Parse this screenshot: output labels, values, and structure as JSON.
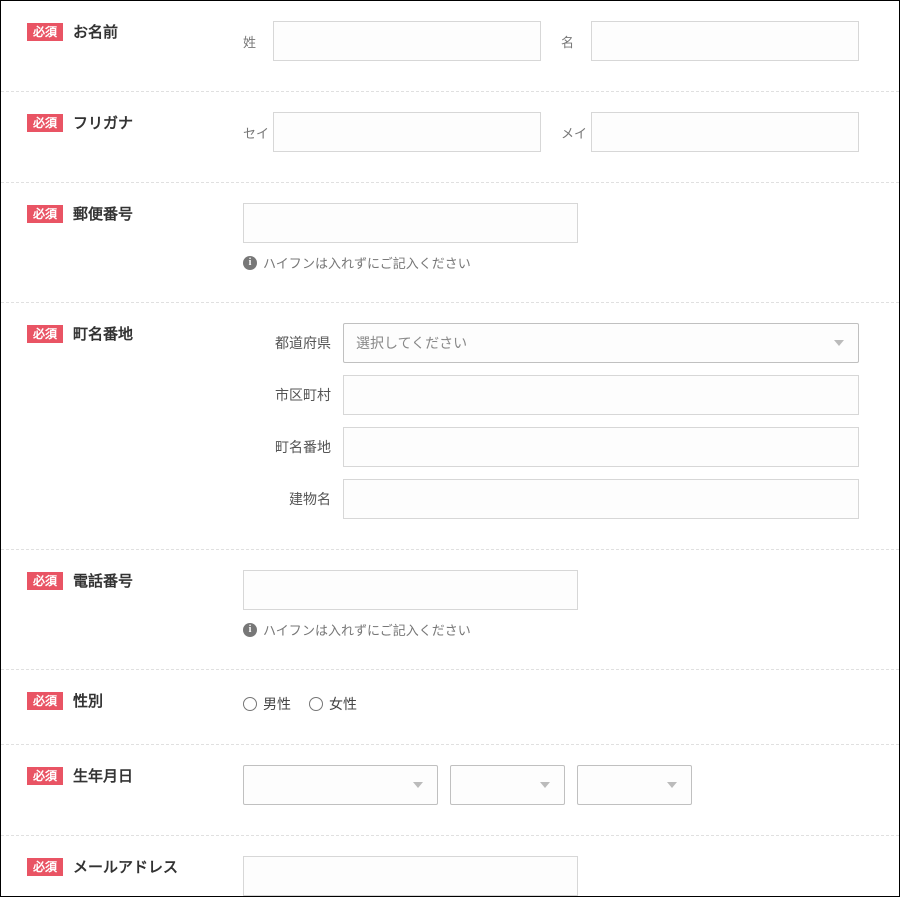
{
  "badge_required": "必須",
  "hint_hyphen": "ハイフンは入れずにご記入ください",
  "name": {
    "label": "お名前",
    "sei": "姓",
    "mei": "名"
  },
  "furigana": {
    "label": "フリガナ",
    "sei": "セイ",
    "mei": "メイ"
  },
  "zip": {
    "label": "郵便番号"
  },
  "address": {
    "label": "町名番地",
    "pref": "都道府県",
    "pref_placeholder": "選択してください",
    "city": "市区町村",
    "street": "町名番地",
    "building": "建物名"
  },
  "phone": {
    "label": "電話番号"
  },
  "gender": {
    "label": "性別",
    "male": "男性",
    "female": "女性"
  },
  "dob": {
    "label": "生年月日"
  },
  "email": {
    "label": "メールアドレス"
  }
}
